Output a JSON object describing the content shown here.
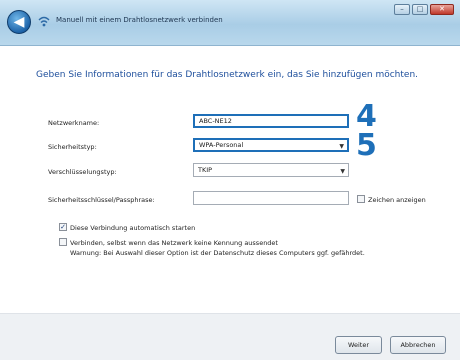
{
  "window": {
    "title": "Manuell mit einem Drahtlosnetzwerk verbinden",
    "controls": {
      "minimize": "–",
      "maximize": "□",
      "close": "✕"
    }
  },
  "heading": "Geben Sie Informationen für das Drahtlosnetzwerk ein, das Sie hinzufügen möchten.",
  "form": {
    "network_name": {
      "label": "Netzwerkname:",
      "value": "ABC-NE12"
    },
    "security_type": {
      "label": "Sicherheitstyp:",
      "value": "WPA-Personal"
    },
    "encryption_type": {
      "label": "Verschlüsselungstyp:",
      "value": "TKIP"
    },
    "security_key": {
      "label": "Sicherheitsschlüssel/Passphrase:",
      "value": ""
    },
    "show_chars": {
      "label": "Zeichen anzeigen",
      "checked": false
    }
  },
  "options": {
    "auto_start": {
      "label": "Diese Verbindung automatisch starten",
      "checked": true
    },
    "connect_hidden": {
      "label": "Verbinden, selbst wenn das Netzwerk keine Kennung aussendet",
      "warning": "Warnung: Bei Auswahl dieser Option ist der Datenschutz dieses Computers ggf. gefährdet.",
      "checked": false
    }
  },
  "annotations": {
    "step_4": "4",
    "step_5": "5"
  },
  "buttons": {
    "next": "Weiter",
    "cancel": "Abbrechen"
  },
  "colors": {
    "accent": "#1e6fb8",
    "heading": "#1e4f9c",
    "title_bar": "#a9cde6"
  },
  "icons": {
    "back": "back-arrow-icon",
    "network": "wireless-network-icon",
    "dropdown": "chevron-down-icon"
  }
}
